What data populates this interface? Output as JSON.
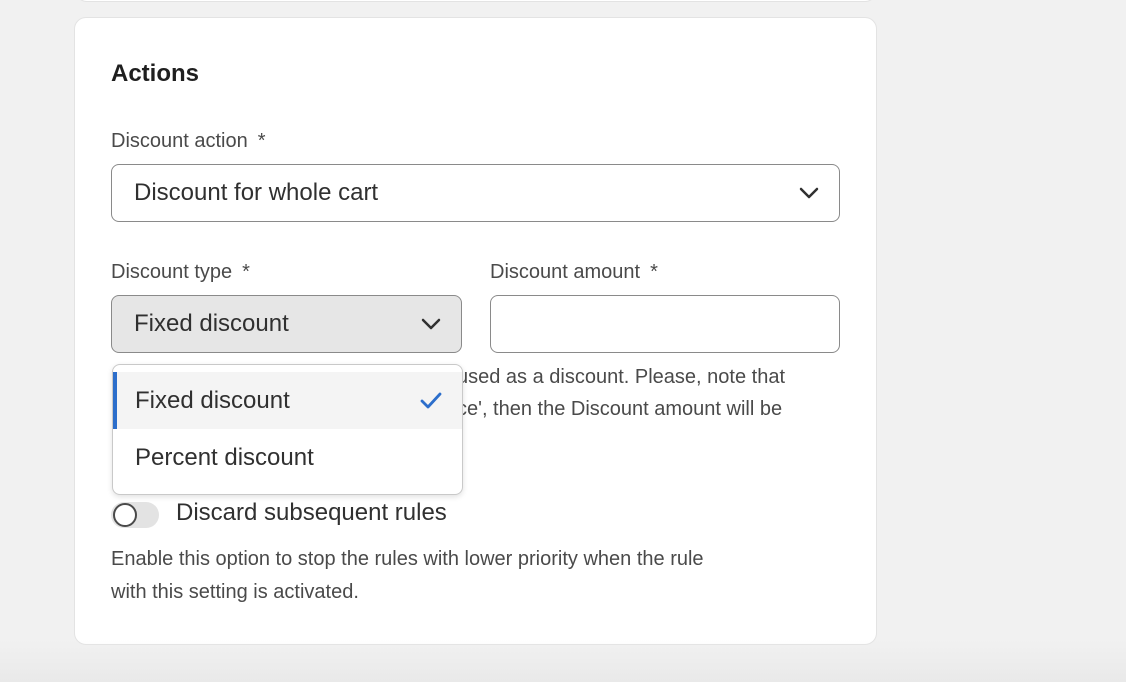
{
  "actions": {
    "title": "Actions",
    "required_mark": "*",
    "discount_action": {
      "label": "Discount action",
      "value": "Discount for whole cart"
    },
    "discount_type": {
      "label": "Discount type",
      "value": "Fixed discount",
      "options": [
        {
          "label": "Fixed discount",
          "selected": true
        },
        {
          "label": "Percent discount",
          "selected": false
        }
      ]
    },
    "discount_amount": {
      "label": "Discount amount",
      "value": ""
    },
    "help_partial": {
      "line1": "used as a discount. Please, note that",
      "line2": "ce', then the Discount amount will be"
    },
    "discard_rules": {
      "label": "Discard subsequent rules",
      "enabled": false,
      "help_line1": "Enable this option to stop the rules with lower priority when the rule",
      "help_line2": "with this setting is activated."
    }
  },
  "colors": {
    "accent": "#2c6ecb",
    "border": "#8a8a8a",
    "card_bg": "#ffffff",
    "page_bg": "#f1f1f1"
  },
  "icons": {
    "select_chevron": "chevron-down-icon",
    "selected_option": "checkmark-icon"
  }
}
